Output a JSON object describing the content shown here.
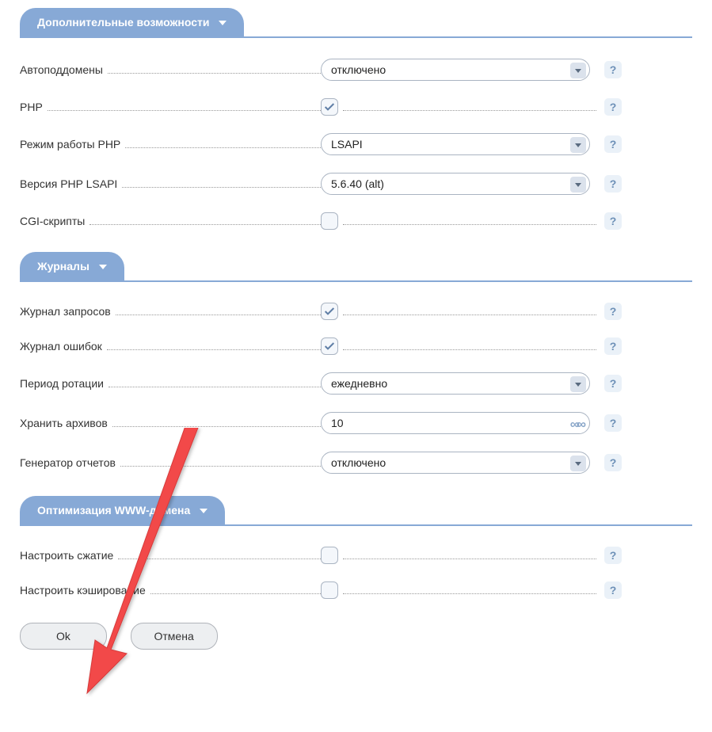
{
  "sections": {
    "advanced": {
      "title": "Дополнительные возможности",
      "rows": {
        "autosub": {
          "label": "Автоподдомены",
          "value": "отключено"
        },
        "php": {
          "label": "PHP",
          "checked": true
        },
        "phpmode": {
          "label": "Режим работы PHP",
          "value": "LSAPI"
        },
        "phpver": {
          "label": "Версия PHP LSAPI",
          "value": "5.6.40 (alt)"
        },
        "cgi": {
          "label": "CGI-скрипты",
          "checked": false
        }
      }
    },
    "logs": {
      "title": "Журналы",
      "rows": {
        "reqlog": {
          "label": "Журнал запросов",
          "checked": true
        },
        "errlog": {
          "label": "Журнал ошибок",
          "checked": true
        },
        "rotate": {
          "label": "Период ротации",
          "value": "ежедневно"
        },
        "keep": {
          "label": "Хранить архивов",
          "value": "10"
        },
        "report": {
          "label": "Генератор отчетов",
          "value": "отключено"
        }
      }
    },
    "optim": {
      "title": "Оптимизация WWW-домена",
      "rows": {
        "compress": {
          "label": "Настроить сжатие",
          "checked": false
        },
        "cache": {
          "label": "Настроить кэширование",
          "checked": false
        }
      }
    }
  },
  "buttons": {
    "ok": "Ok",
    "cancel": "Отмена"
  },
  "help_glyph": "?"
}
